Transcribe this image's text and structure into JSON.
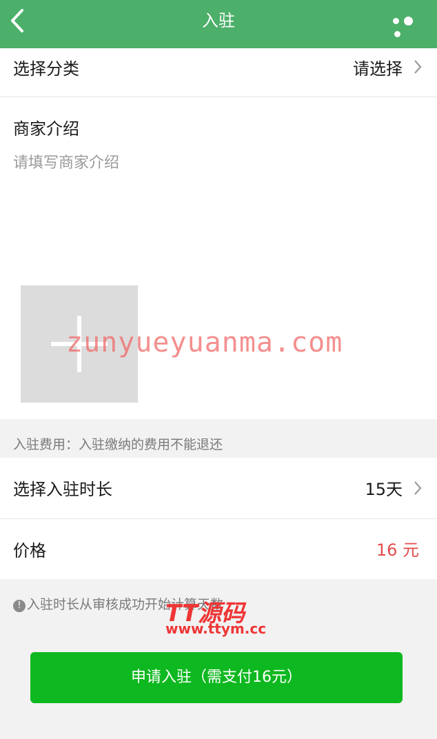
{
  "header": {
    "title": "入驻",
    "back_icon": "chevron-left-icon",
    "more_icon": "more-dots-icon",
    "bg_color": "#4caf6a"
  },
  "category": {
    "label": "选择分类",
    "value": "请选择"
  },
  "intro": {
    "label": "商家介绍",
    "placeholder": "请填写商家介绍"
  },
  "upload": {
    "icon": "plus-icon"
  },
  "fee_note": "入驻费用：入驻缴纳的费用不能退还",
  "duration": {
    "label": "选择入驻时长",
    "value": "15天"
  },
  "price": {
    "label": "价格",
    "value": "16 元",
    "color": "#e24b4b"
  },
  "tip": "入驻时长从审核成功开始计算天数",
  "submit": {
    "label": "申请入驻（需支付16元）",
    "color": "#0eb820"
  },
  "watermarks": {
    "domain": "zunyueyuanma.com",
    "brand": "TT源码",
    "url": "www.ttym.cc"
  }
}
